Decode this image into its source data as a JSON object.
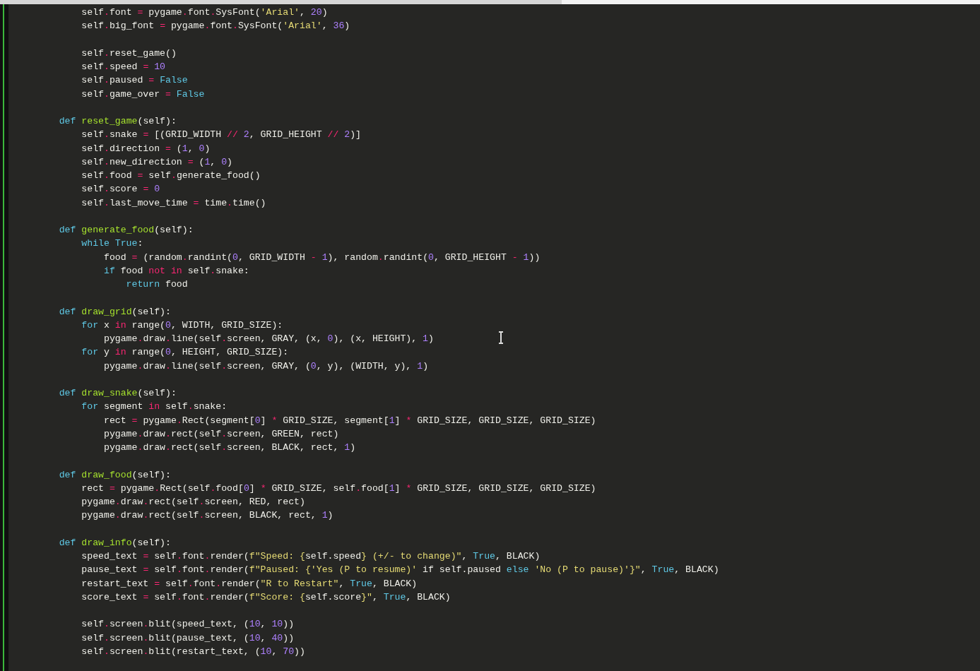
{
  "editor": {
    "lines": [
      {
        "kind": "code",
        "tokens": [
          {
            "kind": "plain",
            "text": "        self"
          },
          {
            "kind": "op",
            "text": "."
          },
          {
            "kind": "plain",
            "text": "font "
          },
          {
            "kind": "op",
            "text": "="
          },
          {
            "kind": "plain",
            "text": " pygame"
          },
          {
            "kind": "op",
            "text": "."
          },
          {
            "kind": "plain",
            "text": "font"
          },
          {
            "kind": "op",
            "text": "."
          },
          {
            "kind": "plain",
            "text": "SysFont("
          },
          {
            "kind": "str",
            "text": "'Arial'"
          },
          {
            "kind": "plain",
            "text": ", "
          },
          {
            "kind": "num",
            "text": "20"
          },
          {
            "kind": "plain",
            "text": ")"
          }
        ]
      },
      {
        "kind": "code",
        "tokens": [
          {
            "kind": "plain",
            "text": "        self"
          },
          {
            "kind": "op",
            "text": "."
          },
          {
            "kind": "plain",
            "text": "big_font "
          },
          {
            "kind": "op",
            "text": "="
          },
          {
            "kind": "plain",
            "text": " pygame"
          },
          {
            "kind": "op",
            "text": "."
          },
          {
            "kind": "plain",
            "text": "font"
          },
          {
            "kind": "op",
            "text": "."
          },
          {
            "kind": "plain",
            "text": "SysFont("
          },
          {
            "kind": "str",
            "text": "'Arial'"
          },
          {
            "kind": "plain",
            "text": ", "
          },
          {
            "kind": "num",
            "text": "36"
          },
          {
            "kind": "plain",
            "text": ")"
          }
        ]
      },
      {
        "kind": "blank"
      },
      {
        "kind": "code",
        "tokens": [
          {
            "kind": "plain",
            "text": "        self"
          },
          {
            "kind": "op",
            "text": "."
          },
          {
            "kind": "plain",
            "text": "reset_game()"
          }
        ]
      },
      {
        "kind": "code",
        "tokens": [
          {
            "kind": "plain",
            "text": "        self"
          },
          {
            "kind": "op",
            "text": "."
          },
          {
            "kind": "plain",
            "text": "speed "
          },
          {
            "kind": "op",
            "text": "="
          },
          {
            "kind": "num",
            "text": " 10"
          }
        ]
      },
      {
        "kind": "code",
        "tokens": [
          {
            "kind": "plain",
            "text": "        self"
          },
          {
            "kind": "op",
            "text": "."
          },
          {
            "kind": "plain",
            "text": "paused "
          },
          {
            "kind": "op",
            "text": "="
          },
          {
            "kind": "kw",
            "text": " False"
          }
        ]
      },
      {
        "kind": "code",
        "tokens": [
          {
            "kind": "plain",
            "text": "        self"
          },
          {
            "kind": "op",
            "text": "."
          },
          {
            "kind": "plain",
            "text": "game_over "
          },
          {
            "kind": "op",
            "text": "="
          },
          {
            "kind": "kw",
            "text": " False"
          }
        ]
      },
      {
        "kind": "blank"
      },
      {
        "kind": "code",
        "tokens": [
          {
            "kind": "kw",
            "text": "    def"
          },
          {
            "kind": "fn",
            "text": " reset_game"
          },
          {
            "kind": "plain",
            "text": "(self):"
          }
        ]
      },
      {
        "kind": "code",
        "tokens": [
          {
            "kind": "plain",
            "text": "        self"
          },
          {
            "kind": "op",
            "text": "."
          },
          {
            "kind": "plain",
            "text": "snake "
          },
          {
            "kind": "op",
            "text": "="
          },
          {
            "kind": "plain",
            "text": " [(GRID_WIDTH "
          },
          {
            "kind": "op",
            "text": "//"
          },
          {
            "kind": "num",
            "text": " 2"
          },
          {
            "kind": "plain",
            "text": ", GRID_HEIGHT "
          },
          {
            "kind": "op",
            "text": "//"
          },
          {
            "kind": "num",
            "text": " 2"
          },
          {
            "kind": "plain",
            "text": ")]"
          }
        ]
      },
      {
        "kind": "code",
        "tokens": [
          {
            "kind": "plain",
            "text": "        self"
          },
          {
            "kind": "op",
            "text": "."
          },
          {
            "kind": "plain",
            "text": "direction "
          },
          {
            "kind": "op",
            "text": "="
          },
          {
            "kind": "plain",
            "text": " ("
          },
          {
            "kind": "num",
            "text": "1"
          },
          {
            "kind": "plain",
            "text": ", "
          },
          {
            "kind": "num",
            "text": "0"
          },
          {
            "kind": "plain",
            "text": ")"
          }
        ]
      },
      {
        "kind": "code",
        "tokens": [
          {
            "kind": "plain",
            "text": "        self"
          },
          {
            "kind": "op",
            "text": "."
          },
          {
            "kind": "plain",
            "text": "new_direction "
          },
          {
            "kind": "op",
            "text": "="
          },
          {
            "kind": "plain",
            "text": " ("
          },
          {
            "kind": "num",
            "text": "1"
          },
          {
            "kind": "plain",
            "text": ", "
          },
          {
            "kind": "num",
            "text": "0"
          },
          {
            "kind": "plain",
            "text": ")"
          }
        ]
      },
      {
        "kind": "code",
        "tokens": [
          {
            "kind": "plain",
            "text": "        self"
          },
          {
            "kind": "op",
            "text": "."
          },
          {
            "kind": "plain",
            "text": "food "
          },
          {
            "kind": "op",
            "text": "="
          },
          {
            "kind": "plain",
            "text": " self"
          },
          {
            "kind": "op",
            "text": "."
          },
          {
            "kind": "plain",
            "text": "generate_food()"
          }
        ]
      },
      {
        "kind": "code",
        "tokens": [
          {
            "kind": "plain",
            "text": "        self"
          },
          {
            "kind": "op",
            "text": "."
          },
          {
            "kind": "plain",
            "text": "score "
          },
          {
            "kind": "op",
            "text": "="
          },
          {
            "kind": "num",
            "text": " 0"
          }
        ]
      },
      {
        "kind": "code",
        "tokens": [
          {
            "kind": "plain",
            "text": "        self"
          },
          {
            "kind": "op",
            "text": "."
          },
          {
            "kind": "plain",
            "text": "last_move_time "
          },
          {
            "kind": "op",
            "text": "="
          },
          {
            "kind": "plain",
            "text": " time"
          },
          {
            "kind": "op",
            "text": "."
          },
          {
            "kind": "plain",
            "text": "time()"
          }
        ]
      },
      {
        "kind": "blank"
      },
      {
        "kind": "code",
        "tokens": [
          {
            "kind": "kw",
            "text": "    def"
          },
          {
            "kind": "fn",
            "text": " generate_food"
          },
          {
            "kind": "plain",
            "text": "(self):"
          }
        ]
      },
      {
        "kind": "code",
        "tokens": [
          {
            "kind": "kw",
            "text": "        while True"
          },
          {
            "kind": "plain",
            "text": ":"
          }
        ]
      },
      {
        "kind": "code",
        "tokens": [
          {
            "kind": "plain",
            "text": "            food "
          },
          {
            "kind": "op",
            "text": "="
          },
          {
            "kind": "plain",
            "text": " (random"
          },
          {
            "kind": "op",
            "text": "."
          },
          {
            "kind": "plain",
            "text": "randint("
          },
          {
            "kind": "num",
            "text": "0"
          },
          {
            "kind": "plain",
            "text": ", GRID_WIDTH "
          },
          {
            "kind": "op",
            "text": "-"
          },
          {
            "kind": "num",
            "text": " 1"
          },
          {
            "kind": "plain",
            "text": "), random"
          },
          {
            "kind": "op",
            "text": "."
          },
          {
            "kind": "plain",
            "text": "randint("
          },
          {
            "kind": "num",
            "text": "0"
          },
          {
            "kind": "plain",
            "text": ", GRID_HEIGHT "
          },
          {
            "kind": "op",
            "text": "-"
          },
          {
            "kind": "num",
            "text": " 1"
          },
          {
            "kind": "plain",
            "text": "))"
          }
        ]
      },
      {
        "kind": "code",
        "tokens": [
          {
            "kind": "kw",
            "text": "            if"
          },
          {
            "kind": "plain",
            "text": " food "
          },
          {
            "kind": "op",
            "text": "not in"
          },
          {
            "kind": "plain",
            "text": " self"
          },
          {
            "kind": "op",
            "text": "."
          },
          {
            "kind": "plain",
            "text": "snake:"
          }
        ]
      },
      {
        "kind": "code",
        "tokens": [
          {
            "kind": "kw",
            "text": "                return"
          },
          {
            "kind": "plain",
            "text": " food"
          }
        ]
      },
      {
        "kind": "blank"
      },
      {
        "kind": "code",
        "tokens": [
          {
            "kind": "kw",
            "text": "    def"
          },
          {
            "kind": "fn",
            "text": " draw_grid"
          },
          {
            "kind": "plain",
            "text": "(self):"
          }
        ]
      },
      {
        "kind": "code",
        "tokens": [
          {
            "kind": "kw",
            "text": "        for"
          },
          {
            "kind": "plain",
            "text": " x "
          },
          {
            "kind": "op",
            "text": "in"
          },
          {
            "kind": "plain",
            "text": " range("
          },
          {
            "kind": "num",
            "text": "0"
          },
          {
            "kind": "plain",
            "text": ", WIDTH, GRID_SIZE):"
          }
        ]
      },
      {
        "kind": "code",
        "tokens": [
          {
            "kind": "plain",
            "text": "            pygame"
          },
          {
            "kind": "op",
            "text": "."
          },
          {
            "kind": "plain",
            "text": "draw"
          },
          {
            "kind": "op",
            "text": "."
          },
          {
            "kind": "plain",
            "text": "line(self"
          },
          {
            "kind": "op",
            "text": "."
          },
          {
            "kind": "plain",
            "text": "screen, GRAY, (x, "
          },
          {
            "kind": "num",
            "text": "0"
          },
          {
            "kind": "plain",
            "text": "), (x, HEIGHT), "
          },
          {
            "kind": "num",
            "text": "1"
          },
          {
            "kind": "plain",
            "text": ")"
          }
        ]
      },
      {
        "kind": "code",
        "tokens": [
          {
            "kind": "kw",
            "text": "        for"
          },
          {
            "kind": "plain",
            "text": " y "
          },
          {
            "kind": "op",
            "text": "in"
          },
          {
            "kind": "plain",
            "text": " range("
          },
          {
            "kind": "num",
            "text": "0"
          },
          {
            "kind": "plain",
            "text": ", HEIGHT, GRID_SIZE):"
          }
        ]
      },
      {
        "kind": "code",
        "tokens": [
          {
            "kind": "plain",
            "text": "            pygame"
          },
          {
            "kind": "op",
            "text": "."
          },
          {
            "kind": "plain",
            "text": "draw"
          },
          {
            "kind": "op",
            "text": "."
          },
          {
            "kind": "plain",
            "text": "line(self"
          },
          {
            "kind": "op",
            "text": "."
          },
          {
            "kind": "plain",
            "text": "screen, GRAY, ("
          },
          {
            "kind": "num",
            "text": "0"
          },
          {
            "kind": "plain",
            "text": ", y), (WIDTH, y), "
          },
          {
            "kind": "num",
            "text": "1"
          },
          {
            "kind": "plain",
            "text": ")"
          }
        ]
      },
      {
        "kind": "blank"
      },
      {
        "kind": "code",
        "tokens": [
          {
            "kind": "kw",
            "text": "    def"
          },
          {
            "kind": "fn",
            "text": " draw_snake"
          },
          {
            "kind": "plain",
            "text": "(self):"
          }
        ]
      },
      {
        "kind": "code",
        "tokens": [
          {
            "kind": "kw",
            "text": "        for"
          },
          {
            "kind": "plain",
            "text": " segment "
          },
          {
            "kind": "op",
            "text": "in"
          },
          {
            "kind": "plain",
            "text": " self"
          },
          {
            "kind": "op",
            "text": "."
          },
          {
            "kind": "plain",
            "text": "snake:"
          }
        ]
      },
      {
        "kind": "code",
        "tokens": [
          {
            "kind": "plain",
            "text": "            rect "
          },
          {
            "kind": "op",
            "text": "="
          },
          {
            "kind": "plain",
            "text": " pygame"
          },
          {
            "kind": "op",
            "text": "."
          },
          {
            "kind": "plain",
            "text": "Rect(segment["
          },
          {
            "kind": "num",
            "text": "0"
          },
          {
            "kind": "plain",
            "text": "] "
          },
          {
            "kind": "op",
            "text": "*"
          },
          {
            "kind": "plain",
            "text": " GRID_SIZE, segment["
          },
          {
            "kind": "num",
            "text": "1"
          },
          {
            "kind": "plain",
            "text": "] "
          },
          {
            "kind": "op",
            "text": "*"
          },
          {
            "kind": "plain",
            "text": " GRID_SIZE, GRID_SIZE, GRID_SIZE)"
          }
        ]
      },
      {
        "kind": "code",
        "tokens": [
          {
            "kind": "plain",
            "text": "            pygame"
          },
          {
            "kind": "op",
            "text": "."
          },
          {
            "kind": "plain",
            "text": "draw"
          },
          {
            "kind": "op",
            "text": "."
          },
          {
            "kind": "plain",
            "text": "rect(self"
          },
          {
            "kind": "op",
            "text": "."
          },
          {
            "kind": "plain",
            "text": "screen, GREEN, rect)"
          }
        ]
      },
      {
        "kind": "code",
        "tokens": [
          {
            "kind": "plain",
            "text": "            pygame"
          },
          {
            "kind": "op",
            "text": "."
          },
          {
            "kind": "plain",
            "text": "draw"
          },
          {
            "kind": "op",
            "text": "."
          },
          {
            "kind": "plain",
            "text": "rect(self"
          },
          {
            "kind": "op",
            "text": "."
          },
          {
            "kind": "plain",
            "text": "screen, BLACK, rect, "
          },
          {
            "kind": "num",
            "text": "1"
          },
          {
            "kind": "plain",
            "text": ")"
          }
        ]
      },
      {
        "kind": "blank"
      },
      {
        "kind": "code",
        "tokens": [
          {
            "kind": "kw",
            "text": "    def"
          },
          {
            "kind": "fn",
            "text": " draw_food"
          },
          {
            "kind": "plain",
            "text": "(self):"
          }
        ]
      },
      {
        "kind": "code",
        "tokens": [
          {
            "kind": "plain",
            "text": "        rect "
          },
          {
            "kind": "op",
            "text": "="
          },
          {
            "kind": "plain",
            "text": " pygame"
          },
          {
            "kind": "op",
            "text": "."
          },
          {
            "kind": "plain",
            "text": "Rect(self"
          },
          {
            "kind": "op",
            "text": "."
          },
          {
            "kind": "plain",
            "text": "food["
          },
          {
            "kind": "num",
            "text": "0"
          },
          {
            "kind": "plain",
            "text": "] "
          },
          {
            "kind": "op",
            "text": "*"
          },
          {
            "kind": "plain",
            "text": " GRID_SIZE, self"
          },
          {
            "kind": "op",
            "text": "."
          },
          {
            "kind": "plain",
            "text": "food["
          },
          {
            "kind": "num",
            "text": "1"
          },
          {
            "kind": "plain",
            "text": "] "
          },
          {
            "kind": "op",
            "text": "*"
          },
          {
            "kind": "plain",
            "text": " GRID_SIZE, GRID_SIZE, GRID_SIZE)"
          }
        ]
      },
      {
        "kind": "code",
        "tokens": [
          {
            "kind": "plain",
            "text": "        pygame"
          },
          {
            "kind": "op",
            "text": "."
          },
          {
            "kind": "plain",
            "text": "draw"
          },
          {
            "kind": "op",
            "text": "."
          },
          {
            "kind": "plain",
            "text": "rect(self"
          },
          {
            "kind": "op",
            "text": "."
          },
          {
            "kind": "plain",
            "text": "screen, RED, rect)"
          }
        ]
      },
      {
        "kind": "code",
        "tokens": [
          {
            "kind": "plain",
            "text": "        pygame"
          },
          {
            "kind": "op",
            "text": "."
          },
          {
            "kind": "plain",
            "text": "draw"
          },
          {
            "kind": "op",
            "text": "."
          },
          {
            "kind": "plain",
            "text": "rect(self"
          },
          {
            "kind": "op",
            "text": "."
          },
          {
            "kind": "plain",
            "text": "screen, BLACK, rect, "
          },
          {
            "kind": "num",
            "text": "1"
          },
          {
            "kind": "plain",
            "text": ")"
          }
        ]
      },
      {
        "kind": "blank"
      },
      {
        "kind": "code",
        "tokens": [
          {
            "kind": "kw",
            "text": "    def"
          },
          {
            "kind": "fn",
            "text": " draw_info"
          },
          {
            "kind": "plain",
            "text": "(self):"
          }
        ]
      },
      {
        "kind": "code",
        "tokens": [
          {
            "kind": "plain",
            "text": "        speed_text "
          },
          {
            "kind": "op",
            "text": "="
          },
          {
            "kind": "plain",
            "text": " self"
          },
          {
            "kind": "op",
            "text": "."
          },
          {
            "kind": "plain",
            "text": "font"
          },
          {
            "kind": "op",
            "text": "."
          },
          {
            "kind": "plain",
            "text": "render("
          },
          {
            "kind": "str",
            "text": "f\"Speed: {"
          },
          {
            "kind": "plain",
            "text": "self.speed"
          },
          {
            "kind": "str",
            "text": "} (+/- to change)\""
          },
          {
            "kind": "plain",
            "text": ", "
          },
          {
            "kind": "kw",
            "text": "True"
          },
          {
            "kind": "plain",
            "text": ", BLACK)"
          }
        ]
      },
      {
        "kind": "code",
        "tokens": [
          {
            "kind": "plain",
            "text": "        pause_text "
          },
          {
            "kind": "op",
            "text": "="
          },
          {
            "kind": "plain",
            "text": " self"
          },
          {
            "kind": "op",
            "text": "."
          },
          {
            "kind": "plain",
            "text": "font"
          },
          {
            "kind": "op",
            "text": "."
          },
          {
            "kind": "plain",
            "text": "render("
          },
          {
            "kind": "str",
            "text": "f\"Paused: {'Yes (P to resume)'"
          },
          {
            "kind": "plain",
            "text": " if self.paused "
          },
          {
            "kind": "kw",
            "text": "else"
          },
          {
            "kind": "str",
            "text": " 'No (P to pause)'}\""
          },
          {
            "kind": "plain",
            "text": ", "
          },
          {
            "kind": "kw",
            "text": "True"
          },
          {
            "kind": "plain",
            "text": ", BLACK)"
          }
        ]
      },
      {
        "kind": "code",
        "tokens": [
          {
            "kind": "plain",
            "text": "        restart_text "
          },
          {
            "kind": "op",
            "text": "="
          },
          {
            "kind": "plain",
            "text": " self"
          },
          {
            "kind": "op",
            "text": "."
          },
          {
            "kind": "plain",
            "text": "font"
          },
          {
            "kind": "op",
            "text": "."
          },
          {
            "kind": "plain",
            "text": "render("
          },
          {
            "kind": "str",
            "text": "\"R to Restart\""
          },
          {
            "kind": "plain",
            "text": ", "
          },
          {
            "kind": "kw",
            "text": "True"
          },
          {
            "kind": "plain",
            "text": ", BLACK)"
          }
        ]
      },
      {
        "kind": "code",
        "tokens": [
          {
            "kind": "plain",
            "text": "        score_text "
          },
          {
            "kind": "op",
            "text": "="
          },
          {
            "kind": "plain",
            "text": " self"
          },
          {
            "kind": "op",
            "text": "."
          },
          {
            "kind": "plain",
            "text": "font"
          },
          {
            "kind": "op",
            "text": "."
          },
          {
            "kind": "plain",
            "text": "render("
          },
          {
            "kind": "str",
            "text": "f\"Score: {"
          },
          {
            "kind": "plain",
            "text": "self.score"
          },
          {
            "kind": "str",
            "text": "}\""
          },
          {
            "kind": "plain",
            "text": ", "
          },
          {
            "kind": "kw",
            "text": "True"
          },
          {
            "kind": "plain",
            "text": ", BLACK)"
          }
        ]
      },
      {
        "kind": "blank"
      },
      {
        "kind": "code",
        "tokens": [
          {
            "kind": "plain",
            "text": "        self"
          },
          {
            "kind": "op",
            "text": "."
          },
          {
            "kind": "plain",
            "text": "screen"
          },
          {
            "kind": "op",
            "text": "."
          },
          {
            "kind": "plain",
            "text": "blit(speed_text, ("
          },
          {
            "kind": "num",
            "text": "10"
          },
          {
            "kind": "plain",
            "text": ", "
          },
          {
            "kind": "num",
            "text": "10"
          },
          {
            "kind": "plain",
            "text": "))"
          }
        ]
      },
      {
        "kind": "code",
        "tokens": [
          {
            "kind": "plain",
            "text": "        self"
          },
          {
            "kind": "op",
            "text": "."
          },
          {
            "kind": "plain",
            "text": "screen"
          },
          {
            "kind": "op",
            "text": "."
          },
          {
            "kind": "plain",
            "text": "blit(pause_text, ("
          },
          {
            "kind": "num",
            "text": "10"
          },
          {
            "kind": "plain",
            "text": ", "
          },
          {
            "kind": "num",
            "text": "40"
          },
          {
            "kind": "plain",
            "text": "))"
          }
        ]
      },
      {
        "kind": "code",
        "tokens": [
          {
            "kind": "plain",
            "text": "        self"
          },
          {
            "kind": "op",
            "text": "."
          },
          {
            "kind": "plain",
            "text": "screen"
          },
          {
            "kind": "op",
            "text": "."
          },
          {
            "kind": "plain",
            "text": "blit(restart_text, ("
          },
          {
            "kind": "num",
            "text": "10"
          },
          {
            "kind": "plain",
            "text": ", "
          },
          {
            "kind": "num",
            "text": "70"
          },
          {
            "kind": "plain",
            "text": "))"
          }
        ]
      }
    ]
  }
}
